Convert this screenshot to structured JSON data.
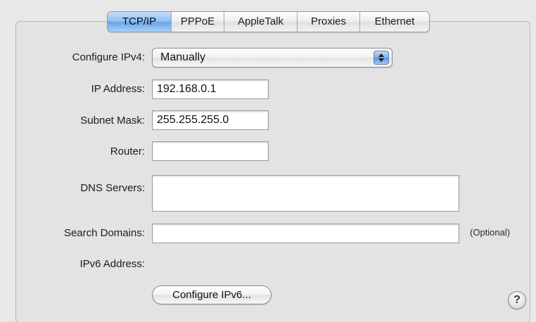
{
  "tabs": [
    {
      "label": "TCP/IP",
      "active": true
    },
    {
      "label": "PPPoE",
      "active": false
    },
    {
      "label": "AppleTalk",
      "active": false
    },
    {
      "label": "Proxies",
      "active": false
    },
    {
      "label": "Ethernet",
      "active": false
    }
  ],
  "configure_ipv4": {
    "label": "Configure IPv4:",
    "value": "Manually"
  },
  "ip_address": {
    "label": "IP Address:",
    "value": "192.168.0.1"
  },
  "subnet_mask": {
    "label": "Subnet Mask:",
    "value": "255.255.255.0"
  },
  "router": {
    "label": "Router:",
    "value": ""
  },
  "dns_servers": {
    "label": "DNS Servers:",
    "value": ""
  },
  "search_domains": {
    "label": "Search Domains:",
    "value": "",
    "hint": "(Optional)"
  },
  "ipv6_address": {
    "label": "IPv6 Address:"
  },
  "configure_ipv6_button": {
    "label": "Configure IPv6..."
  },
  "help_button": {
    "label": "?"
  },
  "colors": {
    "active_tab": "#8fbdf0",
    "popup_arrows": "#7fb1ea",
    "panel_background": "#e3e3e3"
  },
  "icons": {
    "popup": "up-down-arrows-icon",
    "help": "question-mark-icon"
  }
}
